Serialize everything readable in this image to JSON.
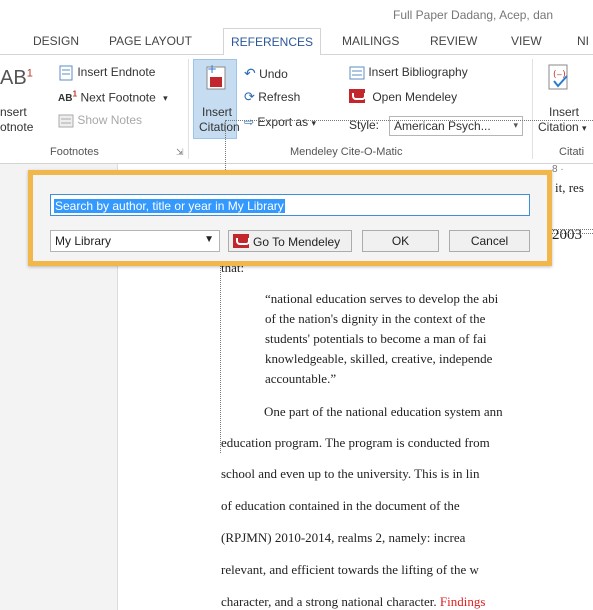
{
  "window": {
    "title": "Full Paper Dadang, Acep, dan"
  },
  "tabs": [
    "DESIGN",
    "PAGE LAYOUT",
    "REFERENCES",
    "MAILINGS",
    "REVIEW",
    "VIEW",
    "NI"
  ],
  "active_tab": "REFERENCES",
  "ribbon": {
    "footnotes": {
      "big_icon_text": "AB",
      "big_label_1": "nsert",
      "big_label_2": "otnote",
      "insert_endnote": "Insert Endnote",
      "next_footnote": "Next Footnote",
      "show_notes": "Show Notes",
      "group_label": "Footnotes"
    },
    "mendeley": {
      "insert_citation_1": "Insert",
      "insert_citation_2": "Citation",
      "undo": "Undo",
      "refresh": "Refresh",
      "export_as": "Export as",
      "insert_bibliography": "Insert Bibliography",
      "open_mendeley": "Open Mendeley",
      "style_label": "Style:",
      "style_value": "American Psych...",
      "group_label": "Mendeley Cite-O-Matic"
    },
    "citations": {
      "insert_1": "Insert",
      "insert_2": "Citation",
      "group_label": "Citati"
    }
  },
  "ruler_text": "8 ·",
  "dialog": {
    "search_placeholder": "Search by author, title or year in My Library",
    "library_select": "My Library",
    "go_to_mendeley": "Go To Mendeley",
    "ok": "OK",
    "cancel": "Cancel"
  },
  "document": {
    "peek_top": "it, res",
    "year_peek": "2003",
    "that_line": "that:",
    "quote_lines": [
      "“national education serves to develop the abi",
      "of the nation's dignity in the context of the",
      "students' potentials to become a man of fai",
      "knowledgeable, skilled, creative, independe",
      "accountable.”"
    ],
    "para_lines": [
      "One part of the national education system ann",
      "education program. The program is conducted from",
      "school and even up to the university. This is in lin",
      "of  education  contained  in  the  document  of  the",
      "(RPJMN)  2010-2014,  realms  2,  namely:  increa",
      "relevant, and efficient towards the lifting of the w"
    ],
    "last_line_black": "character, and a strong national character.",
    "last_line_red": "Findings"
  }
}
